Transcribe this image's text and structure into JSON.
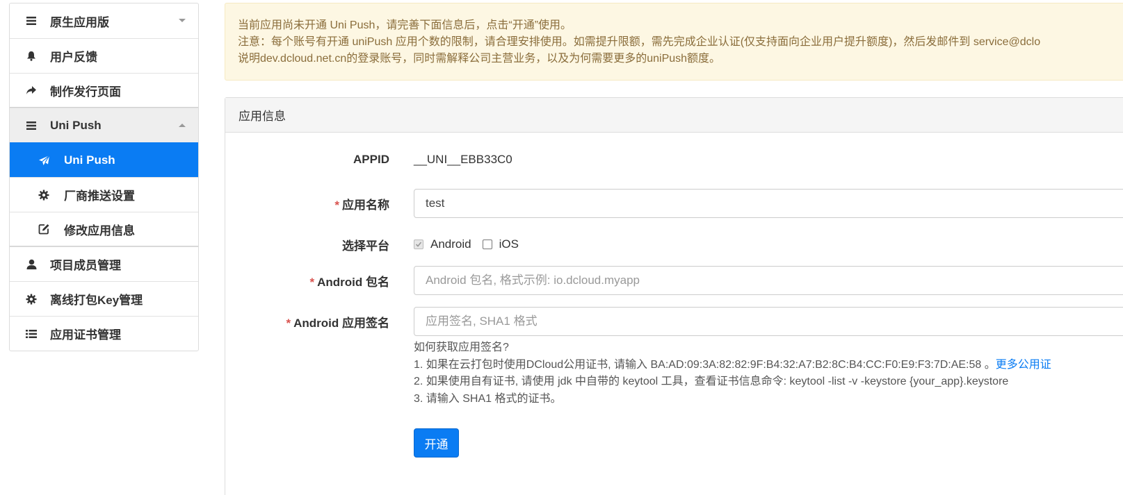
{
  "sidebar": {
    "items": [
      {
        "label": "原生应用版",
        "icon": "bars-icon"
      },
      {
        "label": "用户反馈",
        "icon": "bell-icon"
      },
      {
        "label": "制作发行页面",
        "icon": "share-arrow-icon"
      },
      {
        "label": "Uni Push",
        "icon": "bars-icon"
      },
      {
        "label": "Uni Push",
        "icon": "paper-plane-icon"
      },
      {
        "label": "厂商推送设置",
        "icon": "gear-icon"
      },
      {
        "label": "修改应用信息",
        "icon": "edit-icon"
      },
      {
        "label": "项目成员管理",
        "icon": "user-icon"
      },
      {
        "label": "离线打包Key管理",
        "icon": "gear-icon"
      },
      {
        "label": "应用证书管理",
        "icon": "list-icon"
      }
    ]
  },
  "alert": {
    "line1": "当前应用尚未开通 Uni Push，请完善下面信息后，点击“开通”使用。",
    "line2": "注意：每个账号有开通 uniPush 应用个数的限制，请合理安排使用。如需提升限额，需先完成企业认证(仅支持面向企业用户提升额度)，然后发邮件到 service@dclo",
    "line3": "说明dev.dcloud.net.cn的登录账号，同时需解释公司主营业务，以及为何需要更多的uniPush额度。"
  },
  "panel": {
    "title": "应用信息"
  },
  "form": {
    "appid_label": "APPID",
    "appid_value": "__UNI__EBB33C0",
    "required_mark": "*",
    "appname_label": "应用名称",
    "appname_value": "test",
    "platform_label": "选择平台",
    "platform_android": "Android",
    "platform_ios": "iOS",
    "pkg_label": "Android 包名",
    "pkg_placeholder": "Android 包名, 格式示例: io.dcloud.myapp",
    "sign_label": "Android 应用签名",
    "sign_placeholder": "应用签名, SHA1 格式"
  },
  "help": {
    "title": "如何获取应用签名?",
    "line1": "1. 如果在云打包时使用DCloud公用证书, 请输入 BA:AD:09:3A:82:82:9F:B4:32:A7:B2:8C:B4:CC:F0:E9:F3:7D:AE:58 。",
    "line1_link": "更多公用证",
    "line2": "2. 如果使用自有证书, 请使用 jdk 中自带的 keytool 工具，查看证书信息命令: keytool -list -v -keystore {your_app}.keystore",
    "line3": "3. 请输入 SHA1 格式的证书。"
  },
  "submit_label": "开通",
  "colors": {
    "primary": "#0a7cf3",
    "required": "#d9534f",
    "alert_bg": "#fdf7e3",
    "alert_text": "#8a6d3b"
  }
}
